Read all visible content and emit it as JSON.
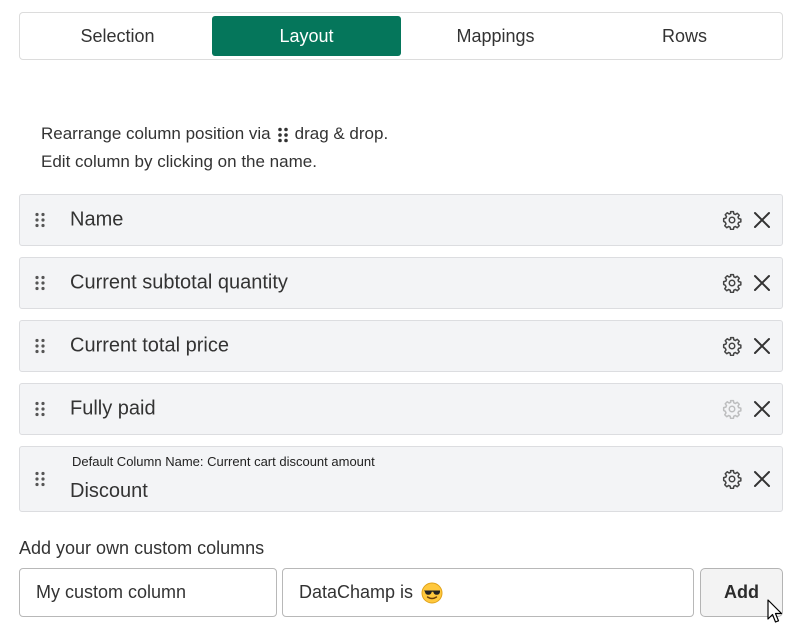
{
  "tabs": [
    {
      "label": "Selection",
      "active": false
    },
    {
      "label": "Layout",
      "active": true
    },
    {
      "label": "Mappings",
      "active": false
    },
    {
      "label": "Rows",
      "active": false
    }
  ],
  "instructions": {
    "line1_before": "Rearrange column position via",
    "line1_after": "drag & drop.",
    "line1_icon": "drag-handle-icon",
    "line2": "Edit column by clicking on the name."
  },
  "columns": [
    {
      "name": "Name",
      "default_name": "",
      "settings_enabled": true
    },
    {
      "name": "Current subtotal quantity",
      "default_name": "",
      "settings_enabled": true
    },
    {
      "name": "Current total price",
      "default_name": "",
      "settings_enabled": true
    },
    {
      "name": "Fully paid",
      "default_name": "",
      "settings_enabled": false
    },
    {
      "name": "Discount",
      "default_name": "Default Column Name: Current cart discount amount",
      "settings_enabled": true
    }
  ],
  "custom": {
    "label": "Add your own custom columns",
    "name_placeholder": "My custom column",
    "value_text": "DataChamp is",
    "value_emoji": "sunglasses-emoji",
    "add_label": "Add"
  },
  "colors": {
    "accent": "#05765b",
    "row_bg": "#f3f4f6",
    "row_border": "#dcdde0"
  }
}
